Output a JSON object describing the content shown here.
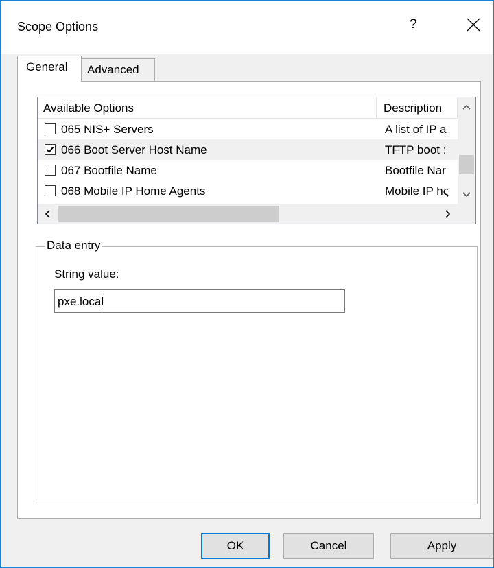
{
  "window": {
    "title": "Scope Options",
    "help": "?",
    "close": "✕"
  },
  "tabs": [
    {
      "label": "General",
      "active": true
    },
    {
      "label": "Advanced",
      "active": false
    }
  ],
  "list": {
    "columns": [
      "Available Options",
      "Description"
    ],
    "rows": [
      {
        "name": "065 NIS+ Servers",
        "description": "A list of IP a",
        "checked": false
      },
      {
        "name": "066 Boot Server Host Name",
        "description": "TFTP boot :",
        "checked": true
      },
      {
        "name": "067 Bootfile Name",
        "description": "Bootfile Nar",
        "checked": false
      },
      {
        "name": "068 Mobile IP Home Agents",
        "description": "Mobile IP hς",
        "checked": false
      }
    ]
  },
  "data_entry": {
    "legend": "Data entry",
    "string_label": "String value:",
    "string_value": "pxe.local"
  },
  "buttons": {
    "ok": "OK",
    "cancel": "Cancel",
    "apply": "Apply"
  },
  "scroll_glyphs": {
    "up": "^",
    "down": "v",
    "left": "<",
    "right": ">"
  }
}
